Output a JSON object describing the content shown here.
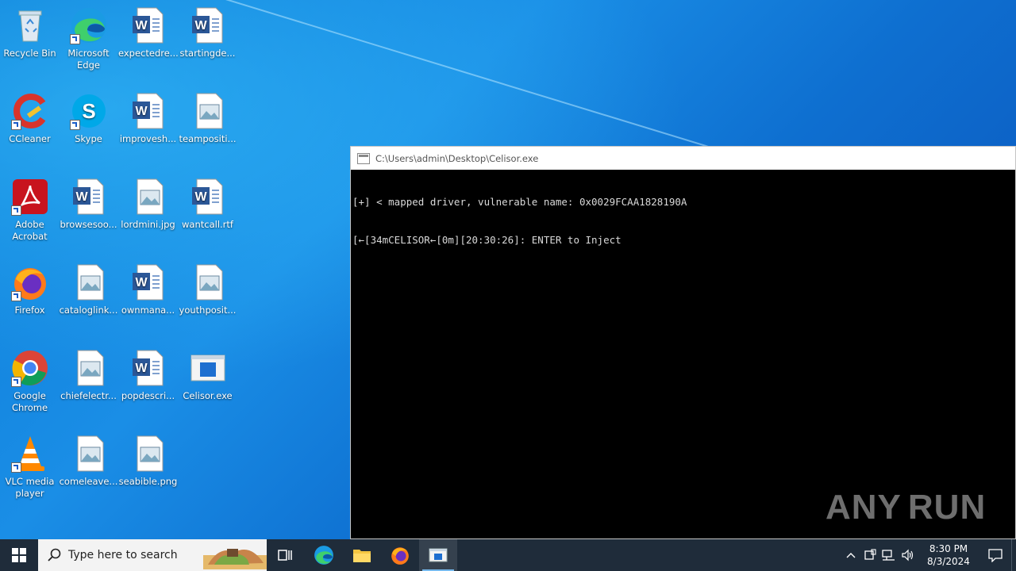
{
  "desktop": {
    "icons": [
      {
        "label": "Recycle Bin",
        "icon": "recycle-bin-icon"
      },
      {
        "label": "Microsoft Edge",
        "icon": "edge-icon"
      },
      {
        "label": "expectedre...",
        "icon": "word-doc-icon"
      },
      {
        "label": "startingde...",
        "icon": "word-doc-icon"
      },
      {
        "label": "CCleaner",
        "icon": "ccleaner-icon"
      },
      {
        "label": "Skype",
        "icon": "skype-icon"
      },
      {
        "label": "improvesh...",
        "icon": "word-doc-icon"
      },
      {
        "label": "teampositi...",
        "icon": "image-file-icon"
      },
      {
        "label": "Adobe Acrobat",
        "icon": "acrobat-icon"
      },
      {
        "label": "browsesoo...",
        "icon": "word-doc-icon"
      },
      {
        "label": "lordmini.jpg",
        "icon": "image-file-icon"
      },
      {
        "label": "wantcall.rtf",
        "icon": "word-doc-icon"
      },
      {
        "label": "Firefox",
        "icon": "firefox-icon"
      },
      {
        "label": "cataloglink...",
        "icon": "image-file-icon"
      },
      {
        "label": "ownmana...",
        "icon": "word-doc-icon"
      },
      {
        "label": "youthposit...",
        "icon": "image-file-icon"
      },
      {
        "label": "Google Chrome",
        "icon": "chrome-icon"
      },
      {
        "label": "chiefelectr...",
        "icon": "image-file-icon"
      },
      {
        "label": "popdescri...",
        "icon": "word-doc-icon"
      },
      {
        "label": "Celisor.exe",
        "icon": "exe-icon"
      },
      {
        "label": "VLC media player",
        "icon": "vlc-icon"
      },
      {
        "label": "comeleave...",
        "icon": "image-file-icon"
      },
      {
        "label": "seabible.png",
        "icon": "image-file-icon"
      }
    ]
  },
  "console": {
    "title": "C:\\Users\\admin\\Desktop\\Celisor.exe",
    "lines": [
      "[+] < mapped driver, vulnerable name: 0x0029FCAA1828190A",
      "[←[34mCELISOR←[0m][20:30:26]: ENTER to Inject"
    ]
  },
  "watermark": {
    "left": "ANY",
    "right": "RUN"
  },
  "taskbar": {
    "search_placeholder": "Type here to search",
    "clock_time": "8:30 PM",
    "clock_date": "8/3/2024",
    "accent": "#76b9ed"
  }
}
